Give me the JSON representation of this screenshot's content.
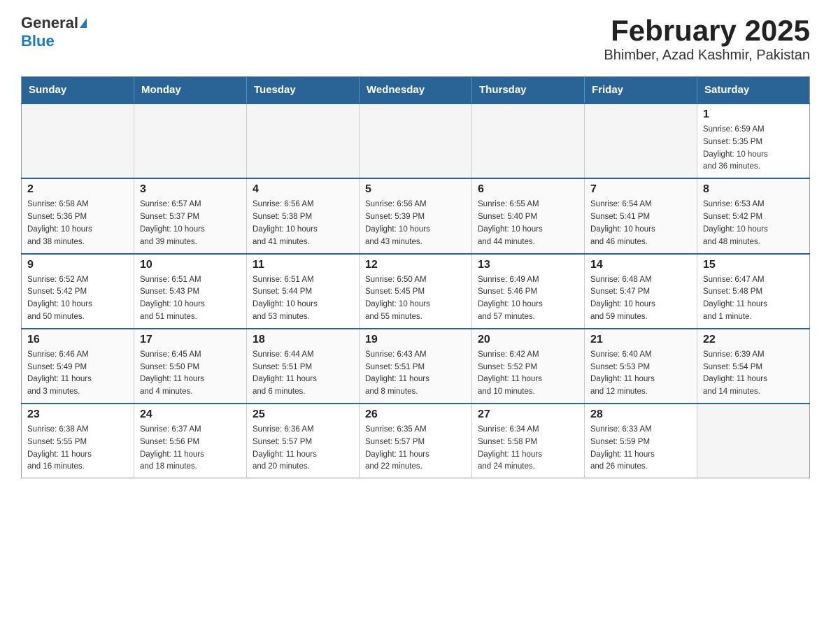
{
  "header": {
    "logo_general": "General",
    "logo_blue": "Blue",
    "title": "February 2025",
    "subtitle": "Bhimber, Azad Kashmir, Pakistan"
  },
  "days_of_week": [
    "Sunday",
    "Monday",
    "Tuesday",
    "Wednesday",
    "Thursday",
    "Friday",
    "Saturday"
  ],
  "weeks": [
    [
      {
        "day": "",
        "info": ""
      },
      {
        "day": "",
        "info": ""
      },
      {
        "day": "",
        "info": ""
      },
      {
        "day": "",
        "info": ""
      },
      {
        "day": "",
        "info": ""
      },
      {
        "day": "",
        "info": ""
      },
      {
        "day": "1",
        "info": "Sunrise: 6:59 AM\nSunset: 5:35 PM\nDaylight: 10 hours\nand 36 minutes."
      }
    ],
    [
      {
        "day": "2",
        "info": "Sunrise: 6:58 AM\nSunset: 5:36 PM\nDaylight: 10 hours\nand 38 minutes."
      },
      {
        "day": "3",
        "info": "Sunrise: 6:57 AM\nSunset: 5:37 PM\nDaylight: 10 hours\nand 39 minutes."
      },
      {
        "day": "4",
        "info": "Sunrise: 6:56 AM\nSunset: 5:38 PM\nDaylight: 10 hours\nand 41 minutes."
      },
      {
        "day": "5",
        "info": "Sunrise: 6:56 AM\nSunset: 5:39 PM\nDaylight: 10 hours\nand 43 minutes."
      },
      {
        "day": "6",
        "info": "Sunrise: 6:55 AM\nSunset: 5:40 PM\nDaylight: 10 hours\nand 44 minutes."
      },
      {
        "day": "7",
        "info": "Sunrise: 6:54 AM\nSunset: 5:41 PM\nDaylight: 10 hours\nand 46 minutes."
      },
      {
        "day": "8",
        "info": "Sunrise: 6:53 AM\nSunset: 5:42 PM\nDaylight: 10 hours\nand 48 minutes."
      }
    ],
    [
      {
        "day": "9",
        "info": "Sunrise: 6:52 AM\nSunset: 5:42 PM\nDaylight: 10 hours\nand 50 minutes."
      },
      {
        "day": "10",
        "info": "Sunrise: 6:51 AM\nSunset: 5:43 PM\nDaylight: 10 hours\nand 51 minutes."
      },
      {
        "day": "11",
        "info": "Sunrise: 6:51 AM\nSunset: 5:44 PM\nDaylight: 10 hours\nand 53 minutes."
      },
      {
        "day": "12",
        "info": "Sunrise: 6:50 AM\nSunset: 5:45 PM\nDaylight: 10 hours\nand 55 minutes."
      },
      {
        "day": "13",
        "info": "Sunrise: 6:49 AM\nSunset: 5:46 PM\nDaylight: 10 hours\nand 57 minutes."
      },
      {
        "day": "14",
        "info": "Sunrise: 6:48 AM\nSunset: 5:47 PM\nDaylight: 10 hours\nand 59 minutes."
      },
      {
        "day": "15",
        "info": "Sunrise: 6:47 AM\nSunset: 5:48 PM\nDaylight: 11 hours\nand 1 minute."
      }
    ],
    [
      {
        "day": "16",
        "info": "Sunrise: 6:46 AM\nSunset: 5:49 PM\nDaylight: 11 hours\nand 3 minutes."
      },
      {
        "day": "17",
        "info": "Sunrise: 6:45 AM\nSunset: 5:50 PM\nDaylight: 11 hours\nand 4 minutes."
      },
      {
        "day": "18",
        "info": "Sunrise: 6:44 AM\nSunset: 5:51 PM\nDaylight: 11 hours\nand 6 minutes."
      },
      {
        "day": "19",
        "info": "Sunrise: 6:43 AM\nSunset: 5:51 PM\nDaylight: 11 hours\nand 8 minutes."
      },
      {
        "day": "20",
        "info": "Sunrise: 6:42 AM\nSunset: 5:52 PM\nDaylight: 11 hours\nand 10 minutes."
      },
      {
        "day": "21",
        "info": "Sunrise: 6:40 AM\nSunset: 5:53 PM\nDaylight: 11 hours\nand 12 minutes."
      },
      {
        "day": "22",
        "info": "Sunrise: 6:39 AM\nSunset: 5:54 PM\nDaylight: 11 hours\nand 14 minutes."
      }
    ],
    [
      {
        "day": "23",
        "info": "Sunrise: 6:38 AM\nSunset: 5:55 PM\nDaylight: 11 hours\nand 16 minutes."
      },
      {
        "day": "24",
        "info": "Sunrise: 6:37 AM\nSunset: 5:56 PM\nDaylight: 11 hours\nand 18 minutes."
      },
      {
        "day": "25",
        "info": "Sunrise: 6:36 AM\nSunset: 5:57 PM\nDaylight: 11 hours\nand 20 minutes."
      },
      {
        "day": "26",
        "info": "Sunrise: 6:35 AM\nSunset: 5:57 PM\nDaylight: 11 hours\nand 22 minutes."
      },
      {
        "day": "27",
        "info": "Sunrise: 6:34 AM\nSunset: 5:58 PM\nDaylight: 11 hours\nand 24 minutes."
      },
      {
        "day": "28",
        "info": "Sunrise: 6:33 AM\nSunset: 5:59 PM\nDaylight: 11 hours\nand 26 minutes."
      },
      {
        "day": "",
        "info": ""
      }
    ]
  ]
}
